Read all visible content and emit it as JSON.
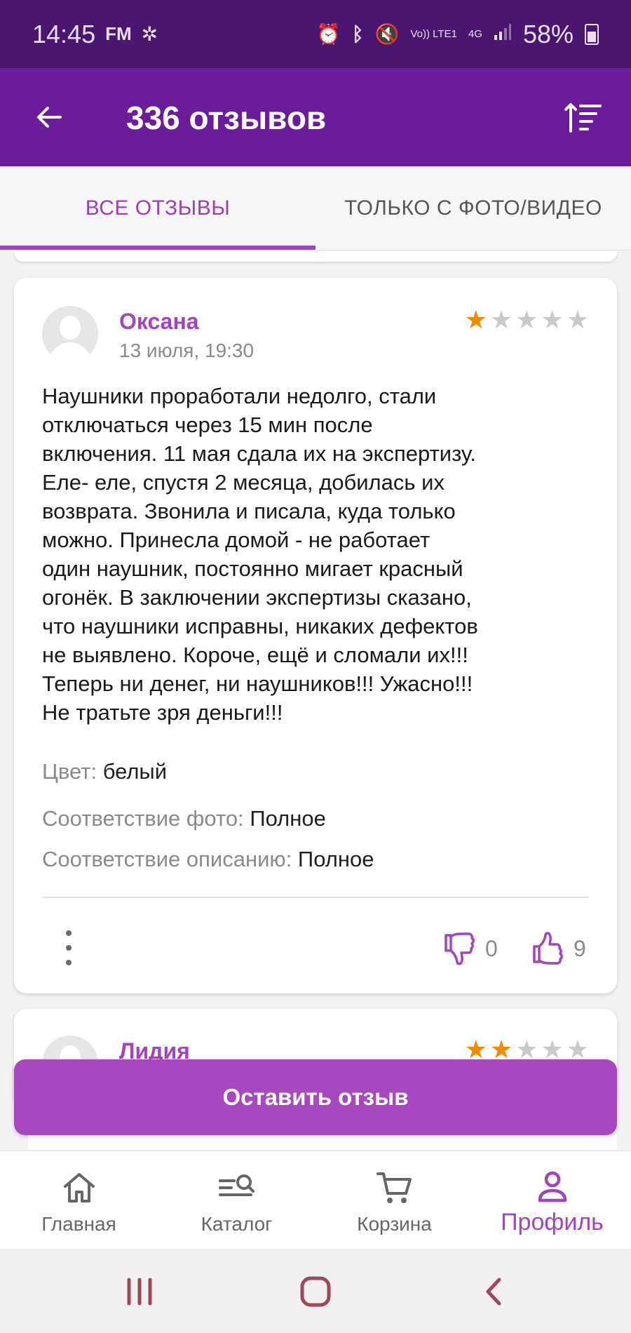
{
  "status_bar": {
    "time": "14:45",
    "left_icons": [
      "fm-radio-icon",
      "fan-icon"
    ],
    "right_icons": [
      "alarm-icon",
      "bluetooth-icon",
      "mute-icon",
      "volte-icon",
      "4g-icon",
      "signal-icon"
    ],
    "volte_label": "Vo)) LTE1",
    "network_label": "4G",
    "battery": "58%"
  },
  "header": {
    "title": "336 отзывов",
    "back_icon": "arrow-left-icon",
    "sort_icon": "sort-icon"
  },
  "tabs": [
    {
      "label": "ВСЕ ОТЗЫВЫ",
      "active": true
    },
    {
      "label": "ТОЛЬКО С ФОТО/ВИДЕО",
      "active": false
    }
  ],
  "reviews": [
    {
      "author": "Оксана",
      "date": "13 июля, 19:30",
      "rating": 1,
      "max_rating": 5,
      "text": "Наушники проработали недолго, стали\nотключаться через 15 мин после\nвключения. 11 мая сдала их на экспертизу.\nЕле- еле, спустя 2 месяца, добилась их\nвозврата. Звонила и писала, куда только\nможно. Принесла домой - не работает\nодин наушник, постоянно мигает красный\nогонёк. В заключении экспертизы сказано,\nчто наушники исправны,  никаких дефектов\nне выявлено. Короче, ещё и сломали их!!!\nТеперь ни денег, ни наушников!!! Ужасно!!!\nНе тратьте зря деньги!!!",
      "attributes": [
        {
          "key": "Цвет:",
          "value": "белый"
        },
        {
          "key": "Соответствие фото:",
          "value": "Полное"
        },
        {
          "key": "Соответствие описанию:",
          "value": "Полное"
        }
      ],
      "dislikes": "0",
      "likes": "9"
    },
    {
      "author": "Лидия",
      "rating": 2,
      "max_rating": 5
    }
  ],
  "cta": {
    "label": "Оставить отзыв"
  },
  "bottom_nav": [
    {
      "label": "Главная",
      "icon": "home-icon",
      "active": false
    },
    {
      "label": "Каталог",
      "icon": "catalog-search-icon",
      "active": false
    },
    {
      "label": "Корзина",
      "icon": "cart-icon",
      "active": false
    },
    {
      "label": "Профиль",
      "icon": "profile-icon",
      "active": true
    }
  ],
  "colors": {
    "status_bar": "#4a1670",
    "app_bar": "#6b1c9a",
    "accent": "#a044c2",
    "star_on": "#f08a00",
    "star_off": "#c9c9c9"
  }
}
